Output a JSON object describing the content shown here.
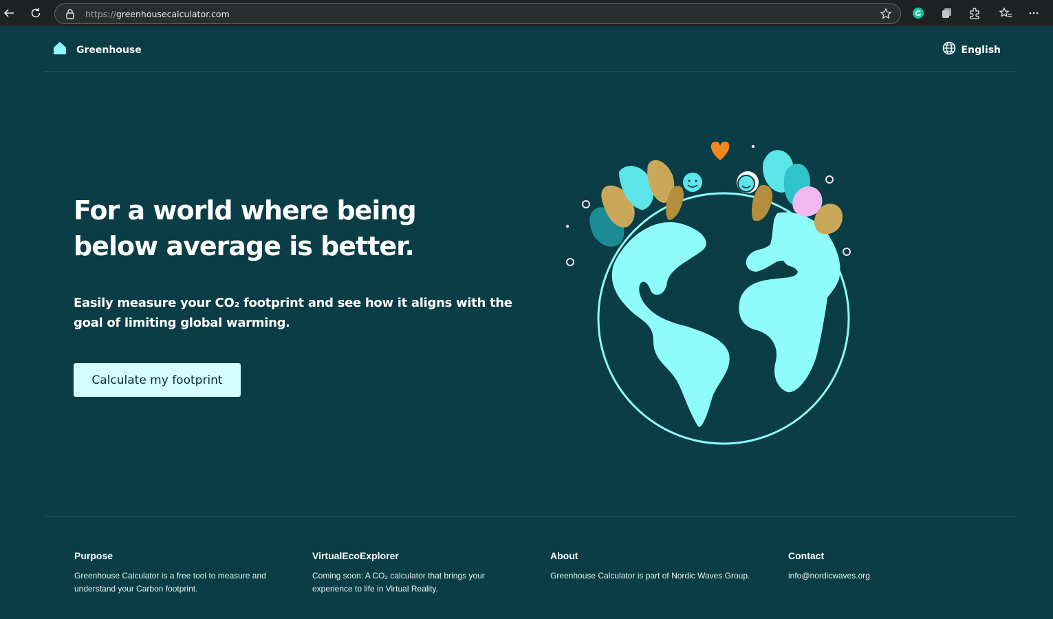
{
  "browser": {
    "url_protocol": "https://",
    "url_host": "greenhousecalculator.com"
  },
  "header": {
    "brand": "Greenhouse",
    "language": "English"
  },
  "hero": {
    "title": "For a world where being below average is better.",
    "subtitle": "Easily measure your CO₂ footprint and see how it aligns with the goal of limiting global warming.",
    "cta_label": "Calculate my footprint"
  },
  "footer": {
    "columns": [
      {
        "title": "Purpose",
        "text": "Greenhouse Calculator is a free tool to measure and understand your Carbon footprint."
      },
      {
        "title": "VirtualEcoExplorer",
        "text": "Coming soon: A CO₂ calculator that brings your experience to life in Virtual Reality."
      },
      {
        "title": "About",
        "text": "Greenhouse Calculator is part of Nordic Waves Group."
      },
      {
        "title": "Contact",
        "text": "info@nordicwaves.org"
      }
    ]
  },
  "colors": {
    "background": "#0a3d45",
    "cta_bg": "#d5fdfd",
    "globe_land": "#8ffcfc",
    "heart": "#f4881f"
  },
  "icons": [
    "back-icon",
    "reload-icon",
    "lock-icon",
    "star-icon",
    "grammarly-icon",
    "collections-icon",
    "extensions-icon",
    "favorites-icon",
    "more-icon",
    "house-icon",
    "globe-icon"
  ]
}
